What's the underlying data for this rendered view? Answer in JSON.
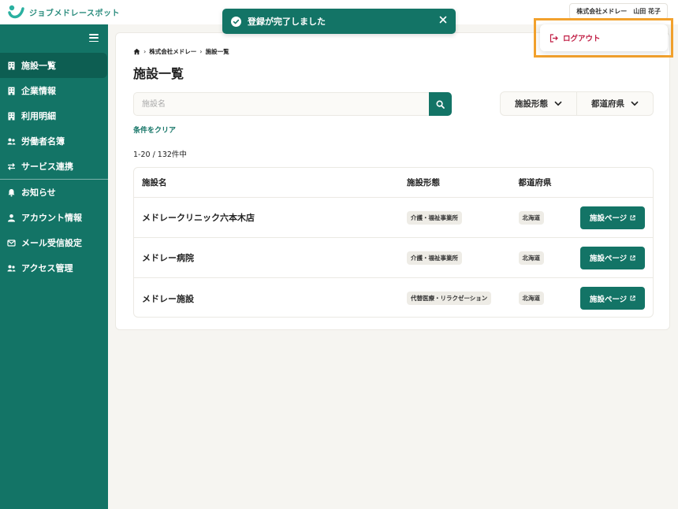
{
  "app": {
    "logo_text": "ジョブメドレースポット",
    "accent_color": "#137466"
  },
  "header": {
    "company": "株式会社メドレー",
    "user_name": "山田 花子"
  },
  "toast": {
    "message": "登録が完了しました"
  },
  "account_menu": {
    "logout_label": "ログアウト"
  },
  "sidebar": {
    "items": [
      {
        "label": "施設一覧",
        "icon": "building-icon"
      },
      {
        "label": "企業情報",
        "icon": "building-icon"
      },
      {
        "label": "利用明細",
        "icon": "building-icon"
      },
      {
        "label": "労働者名簿",
        "icon": "users-icon"
      },
      {
        "label": "サービス連携",
        "icon": "swap-icon"
      },
      {
        "label": "お知らせ",
        "icon": "bell-icon"
      },
      {
        "label": "アカウント情報",
        "icon": "user-icon"
      },
      {
        "label": "メール受信設定",
        "icon": "mail-icon"
      },
      {
        "label": "アクセス管理",
        "icon": "users-icon"
      }
    ]
  },
  "breadcrumb": {
    "company": "株式会社メドレー",
    "current": "施設一覧"
  },
  "page": {
    "title": "施設一覧"
  },
  "search": {
    "placeholder": "施設名",
    "value": ""
  },
  "filters": {
    "facility_type": "施設形態",
    "prefecture": "都道府県",
    "clear": "条件をクリア"
  },
  "results": {
    "count_text": "1-20 / 132件中"
  },
  "table": {
    "headers": [
      "施設名",
      "施設形態",
      "都道府県"
    ],
    "rows": [
      {
        "name": "メドレークリニック六本木店",
        "type": "介護・福祉事業所",
        "pref": "北海道",
        "action": "施設ページ"
      },
      {
        "name": "メドレー病院",
        "type": "介護・福祉事業所",
        "pref": "北海道",
        "action": "施設ページ"
      },
      {
        "name": "メドレー施設",
        "type": "代替医療・リラクゼーション",
        "pref": "北海道",
        "action": "施設ページ"
      }
    ]
  }
}
